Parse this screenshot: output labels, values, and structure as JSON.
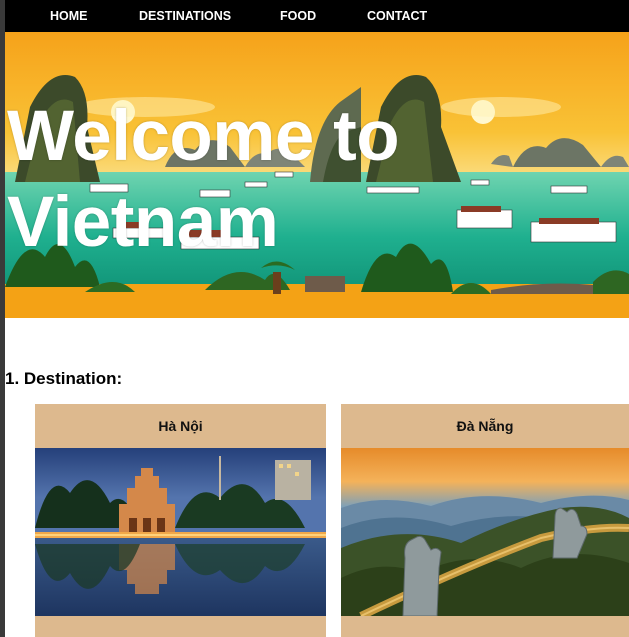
{
  "nav": {
    "items": [
      {
        "label": "HOME"
      },
      {
        "label": "DESTINATIONS"
      },
      {
        "label": "FOOD"
      },
      {
        "label": "CONTACT"
      }
    ]
  },
  "hero": {
    "title": "Welcome to Vietnam"
  },
  "destinations": {
    "heading": "1. Destination:",
    "cards": [
      {
        "title": "Hà Nội"
      },
      {
        "title": "Đà Nẵng"
      }
    ]
  }
}
